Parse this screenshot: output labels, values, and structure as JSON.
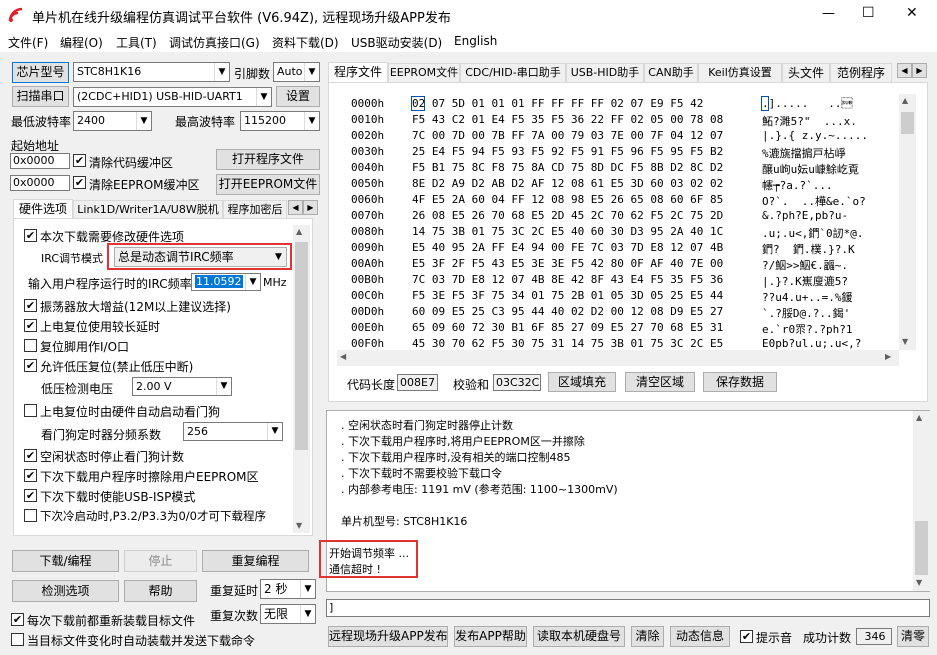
{
  "window": {
    "title": "单片机在线升级编程仿真调试平台软件 (V6.94Z), 远程现场升级APP发布",
    "minimize": "—",
    "maximize": "☐",
    "close": "✕"
  },
  "menu": [
    "文件(F)",
    "编程(O)",
    "工具(T)",
    "调试仿真接口(G)",
    "资料下载(D)",
    "USB驱动安装(D)",
    "English"
  ],
  "left": {
    "chip_btn": "芯片型号",
    "chip_value": "STC8H1K16",
    "pin_label": "引脚数",
    "pin_value": "Auto",
    "scan_btn": "扫描串口",
    "port_value": "(2CDC+HID1) USB-HID-UART1",
    "settings_btn": "设置",
    "min_baud_label": "最低波特率",
    "min_baud": "2400",
    "max_baud_label": "最高波特率",
    "max_baud": "115200",
    "start_addr_label": "起始地址",
    "addr1": "0x0000",
    "clear_code": "清除代码缓冲区",
    "open_prog": "打开程序文件",
    "addr2": "0x0000",
    "clear_eeprom": "清除EEPROM缓冲区",
    "open_eeprom": "打开EEPROM文件",
    "tabs": [
      "硬件选项",
      "Link1D/Writer1A/U8W脱机",
      "程序加密后"
    ],
    "opt_need_modify": "本次下载需要修改硬件选项",
    "irc_label": "IRC调节模式",
    "irc_value": "总是动态调节IRC频率",
    "freq_label": "输入用户程序运行时的IRC频率",
    "freq_value": "11.0592",
    "freq_unit": "MHz",
    "opt_osc_gain": "振荡器放大增益(12M以上建议选择)",
    "opt_long_delay": "上电复位使用较长延时",
    "opt_reset_io": "复位脚用作I/O口",
    "opt_lvd_reset": "允许低压复位(禁止低压中断)",
    "lvd_label": "低压检测电压",
    "lvd_value": "2.00 V",
    "opt_wdt_auto": "上电复位时由硬件自动启动看门狗",
    "wdt_div_label": "看门狗定时器分频系数",
    "wdt_div_value": "256",
    "opt_idle_wdt": "空闲状态时停止看门狗计数",
    "opt_erase_eeprom": "下次下载用户程序时擦除用户EEPROM区",
    "opt_usb_isp": "下次下载时使能USB-ISP模式",
    "opt_p32": "下次冷启动时,P3.2/P3.3为0/0才可下载程序",
    "download_btn": "下载/编程",
    "stop_btn": "停止",
    "reprog_btn": "重复编程",
    "check_btn": "检测选项",
    "help_btn": "帮助",
    "repeat_delay_label": "重复延时",
    "repeat_delay_value": "2 秒",
    "repeat_count_label": "重复次数",
    "repeat_count_value": "无限",
    "opt_reload": "每次下载前都重新装载目标文件",
    "opt_auto_send": "当目标文件变化时自动装载并发送下载命令"
  },
  "right": {
    "tabs": [
      "程序文件",
      "EEPROM文件",
      "CDC/HID-串口助手",
      "USB-HID助手",
      "CAN助手",
      "Keil仿真设置",
      "头文件",
      "范例程序"
    ],
    "hex_rows": [
      {
        "addr": "0000h",
        "bytes": "02 07 5D 01 01 01 FF FF FF FF 02 07 E9 F5 42",
        "ascii": ".].....   ..\u001a"
      },
      {
        "addr": "0010h",
        "bytes": "F5 43 C2 01 E4 F5 35 F5 36 22 FF 02 05 00 78 08",
        "ascii": "鮖?濉5?\"  ...x."
      },
      {
        "addr": "0020h",
        "bytes": "7C 00 7D 00 7B FF 7A 00 79 03 7E 00 7F 04 12 07",
        "ascii": "|.}.{ z.y.~....."
      },
      {
        "addr": "0030h",
        "bytes": "25 E4 F5 94 F5 93 F5 92 F5 91 F5 96 F5 95 F5 B2",
        "ascii": "%漉旐擋掮戸枮崢"
      },
      {
        "addr": "0040h",
        "bytes": "F5 B1 75 8C F8 75 8A CD 75 8D DC F5 8B D2 8C D2",
        "ascii": "醸u岣u妘u嵻鮽屹覔"
      },
      {
        "addr": "0050h",
        "bytes": "8E D2 A9 D2 AB D2 AF 12 08 61 E5 3D 60 03 02 02",
        "ascii": "幰┮?a.?`..."
      },
      {
        "addr": "0060h",
        "bytes": "4F E5 2A 60 04 FF 12 08 98 E5 26 65 08 60 6F 85",
        "ascii": "O?`.  ..樺&e.`o?"
      },
      {
        "addr": "0070h",
        "bytes": "26 08 E5 26 70 68 E5 2D 45 2C 70 62 F5 2C 75 2D",
        "ascii": "&.?ph?E,pb?u-"
      },
      {
        "addr": "0080h",
        "bytes": "14 75 3B 01 75 3C 2C E5 40 60 30 D3 95 2A 40 1C",
        "ascii": ".u;.u<,鍆`0訒*@."
      },
      {
        "addr": "0090h",
        "bytes": "E5 40 95 2A FF E4 94 00 FE 7C 03 7D E8 12 07 4B",
        "ascii": "鍆?  鍆.樸.}?.K"
      },
      {
        "addr": "00A0h",
        "bytes": "E5 3F 2F F5 43 E5 3E 3E F5 42 80 0F AF 40 7E 00",
        "ascii": "?/鮂>>鮂€.疈~."
      },
      {
        "addr": "00B0h",
        "bytes": "7C 03 7D E8 12 07 4B 8E 42 8F 43 E4 F5 35 F5 36",
        "ascii": "|.}?.K嶣廋漉5?"
      },
      {
        "addr": "00C0h",
        "bytes": "F5 3E F5 3F 75 34 01 75 2B 01 05 3D 05 25 E5 44",
        "ascii": "??u4.u+..=.%鍰"
      },
      {
        "addr": "00D0h",
        "bytes": "60 09 E5 25 C3 95 44 40 02 D2 00 12 08 D9 E5 27",
        "ascii": "`.?脮D@.?..鍻'"
      },
      {
        "addr": "00E0h",
        "bytes": "65 09 60 72 30 B1 6F 85 27 09 E5 27 70 68 E5 31",
        "ascii": "e.`r0眔?.?ph?1"
      },
      {
        "addr": "00F0h",
        "bytes": "45 30 70 62 F5 30 75 31 14 75 3B 01 75 3C 2C E5",
        "ascii": "E0pb?ul.u;.u<,?"
      }
    ],
    "code_len_label": "代码长度",
    "code_len": "008E7",
    "checksum_label": "校验和",
    "checksum": "03C32C",
    "fill_btn": "区域填充",
    "clear_btn": "清空区域",
    "save_btn": "保存数据",
    "log_lines": [
      ". 空闲状态时看门狗定时器停止计数",
      ". 下次下载用户程序时,将用户EEPROM区一并擦除",
      ". 下次下载用户程序时,没有相关的端口控制485",
      ". 下次下载时不需要校验下载口令",
      ". 内部参考电压: 1191 mV (参考范围: 1100~1300mV)",
      "",
      "单片机型号: STC8H1K16"
    ],
    "log_highlight": [
      "开始调节频率 ...",
      "通信超时 !"
    ],
    "bottom_input": "]",
    "remote_btn": "远程现场升级APP发布",
    "help_app_btn": "发布APP帮助",
    "read_disk_btn": "读取本机硬盘号",
    "clear_log_btn": "清除",
    "dyn_info_btn": "动态信息",
    "sound_label": "提示音",
    "success_label": "成功计数",
    "success_count": "346",
    "zero_btn": "清零"
  }
}
